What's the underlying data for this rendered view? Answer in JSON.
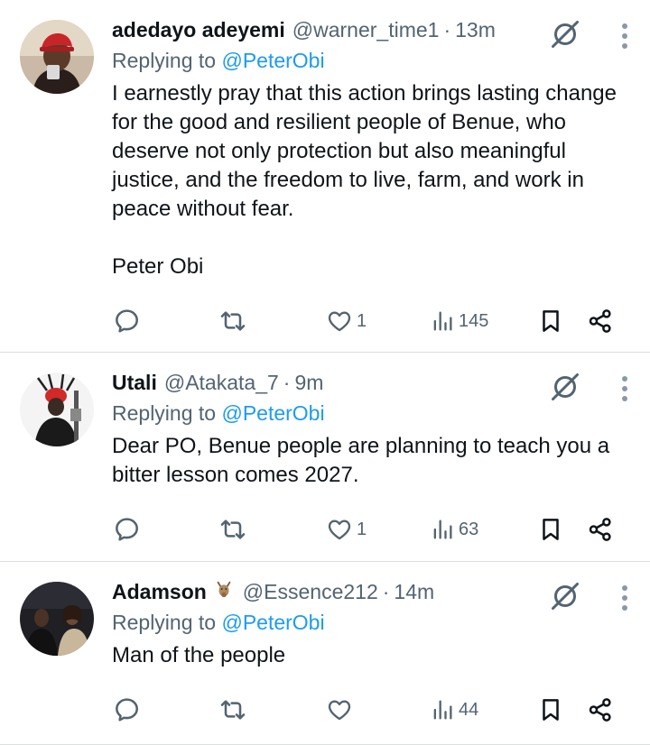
{
  "tweets": [
    {
      "name": "adedayo adeyemi",
      "handle": "@warner_time1",
      "dot": "·",
      "time": "13m",
      "reply_prefix": "Replying to ",
      "reply_to": "@PeterObi",
      "text": "I earnestly pray that this action brings lasting change for the good and resilient people of Benue, who deserve not only protection but also meaningful justice, and the freedom to live, farm, and work in peace without fear.\n\nPeter Obi",
      "likes": "1",
      "views": "145"
    },
    {
      "name": "Utali",
      "handle": "@Atakata_7",
      "dot": "·",
      "time": "9m",
      "reply_prefix": "Replying to ",
      "reply_to": "@PeterObi",
      "text": "Dear PO, Benue people are planning to teach you a bitter lesson comes 2027.",
      "likes": "1",
      "views": "63"
    },
    {
      "name": "Adamson",
      "name_emoji": "goat-emoji",
      "handle": "@Essence212",
      "dot": "·",
      "time": "14m",
      "reply_prefix": "Replying to ",
      "reply_to": "@PeterObi",
      "text": "Man of the people",
      "likes": "",
      "views": "44"
    }
  ],
  "icons": {
    "reply": "reply-icon",
    "retweet": "retweet-icon",
    "like": "heart-icon",
    "views": "views-icon",
    "bookmark": "bookmark-icon",
    "share": "share-icon",
    "grok": "grok-icon",
    "more": "more-vertical-icon"
  },
  "colors": {
    "text": "#0f1419",
    "secondary": "#536471",
    "link": "#1d9bf0",
    "divider": "#dcdfe3"
  }
}
